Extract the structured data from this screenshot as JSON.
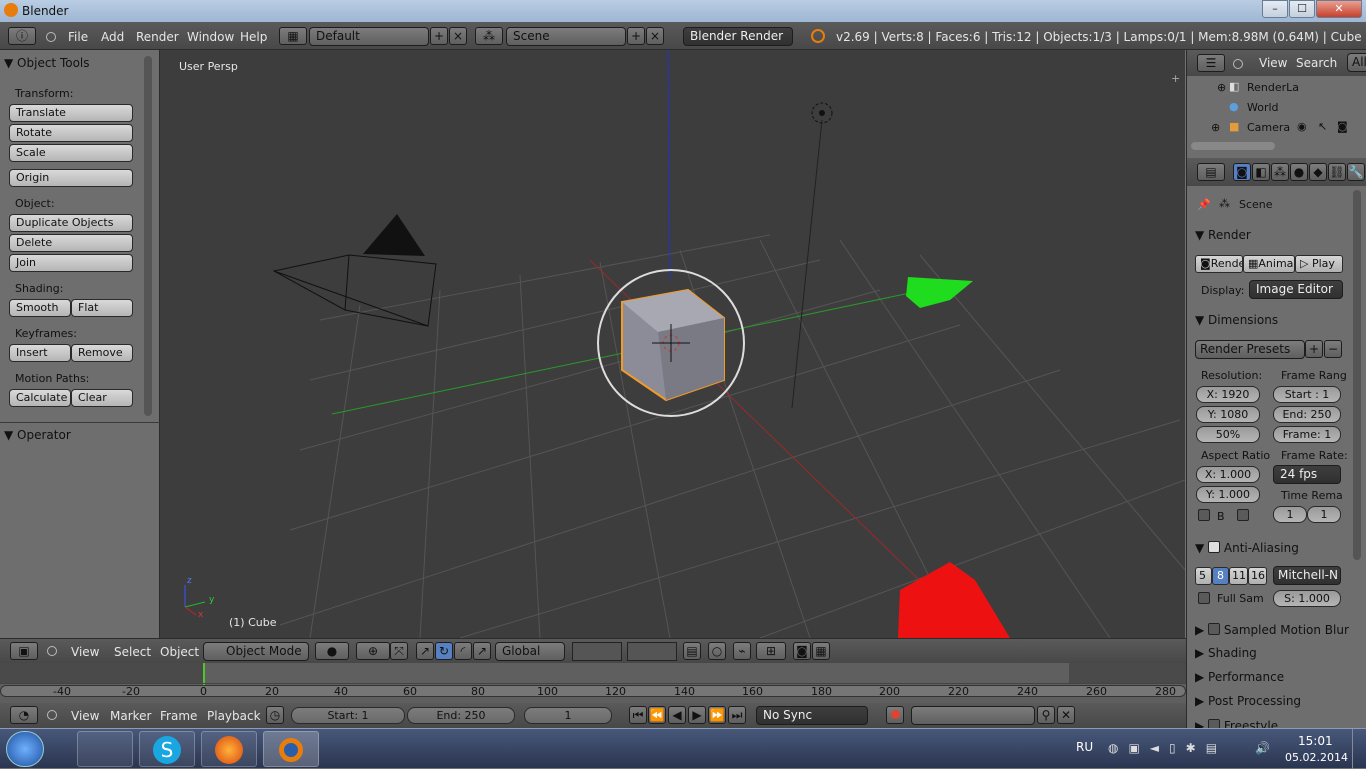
{
  "window": {
    "title": "Blender",
    "min": "–",
    "max": "☐",
    "close": "✕"
  },
  "info": {
    "menus": [
      "File",
      "Add",
      "Render",
      "Window",
      "Help"
    ],
    "screen": "Default",
    "scene": "Scene",
    "engine": "Blender Render",
    "stats": "v2.69 | Verts:8 | Faces:6 | Tris:12 | Objects:1/3 | Lamps:0/1 | Mem:8.98M (0.64M) | Cube"
  },
  "tools": {
    "title": "Object Tools",
    "transform_label": "Transform:",
    "translate": "Translate",
    "rotate": "Rotate",
    "scale": "Scale",
    "origin": "Origin",
    "object_label": "Object:",
    "duplicate": "Duplicate Objects",
    "delete": "Delete",
    "join": "Join",
    "shading_label": "Shading:",
    "smooth": "Smooth",
    "flat": "Flat",
    "keyframes_label": "Keyframes:",
    "insert": "Insert",
    "remove": "Remove",
    "motion_label": "Motion Paths:",
    "calculate": "Calculate",
    "clear": "Clear",
    "operator": "Operator"
  },
  "viewport": {
    "view_name": "User Persp",
    "object_name": "(1) Cube",
    "axis_x": "x",
    "axis_y": "y",
    "axis_z": "z"
  },
  "v3d_header": {
    "menus": [
      "View",
      "Select",
      "Object"
    ],
    "mode": "Object Mode",
    "orientation": "Global"
  },
  "timeline": {
    "ticks": [
      "-40",
      "-20",
      "0",
      "20",
      "40",
      "60",
      "80",
      "100",
      "120",
      "140",
      "160",
      "180",
      "200",
      "220",
      "240",
      "260",
      "280"
    ],
    "menus": [
      "View",
      "Marker",
      "Frame",
      "Playback"
    ],
    "start": "Start: 1",
    "end": "End: 250",
    "frame": "1",
    "sync": "No Sync"
  },
  "outliner": {
    "view": "View",
    "search": "Search",
    "all": "All",
    "items": [
      "RenderLa",
      "World",
      "Camera"
    ]
  },
  "props": {
    "scene": "Scene",
    "render": "Render",
    "render_btn": "Rende",
    "anim_btn": "Anima",
    "play_btn": "Play",
    "display_label": "Display:",
    "display": "Image Editor",
    "dimensions": "Dimensions",
    "presets": "Render Presets",
    "resolution": "Resolution:",
    "res_x": "X: 1920",
    "res_y": "Y: 1080",
    "res_pct": "50%",
    "frame_range": "Frame Rang",
    "start": "Start : 1",
    "end": "End: 250",
    "frame": "Frame: 1",
    "aspect": "Aspect Ratio",
    "asp_x": "X: 1.000",
    "asp_y": "Y: 1.000",
    "frame_rate": "Frame Rate:",
    "fps": "24 fps",
    "time_remap": "Time Rema",
    "remap_a": "1",
    "remap_b": "1",
    "b": "B",
    "aa": "Anti-Aliasing",
    "aa_5": "5",
    "aa_8": "8",
    "aa_11": "11",
    "aa_16": "16",
    "filter": "Mitchell-N",
    "full_sample": "Full Sam",
    "filter_size": "S: 1.000",
    "motion_blur": "Sampled Motion Blur",
    "shading": "Shading",
    "performance": "Performance",
    "post": "Post Processing",
    "freestyle": "Freestyle"
  },
  "taskbar": {
    "lang": "RU",
    "time": "15:01",
    "date": "05.02.2014"
  }
}
